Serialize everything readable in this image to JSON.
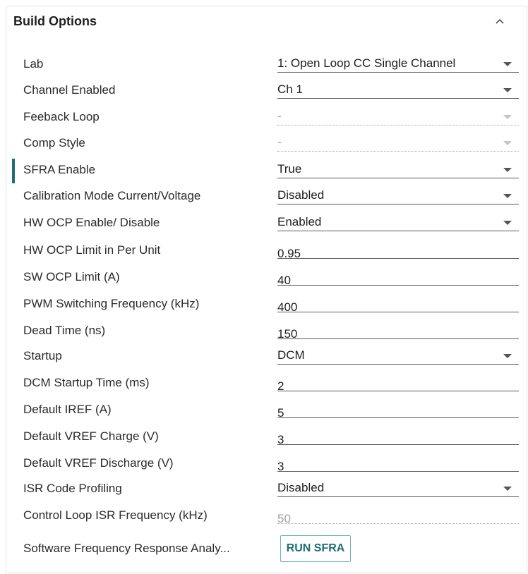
{
  "panel": {
    "title": "Build Options",
    "collapse_icon": "chevron-up-icon",
    "accent_color": "#1f6e78"
  },
  "options": [
    {
      "label": "Lab",
      "value": "1: Open Loop CC Single Channel",
      "type": "select"
    },
    {
      "label": "Channel Enabled",
      "value": "Ch 1",
      "type": "select"
    },
    {
      "label": "Feeback Loop",
      "value": "-",
      "type": "select",
      "disabled": true
    },
    {
      "label": "Comp Style",
      "value": "-",
      "type": "select",
      "disabled": true
    },
    {
      "label": "SFRA Enable",
      "value": "True",
      "type": "select"
    },
    {
      "label": "Calibration Mode Current/Voltage",
      "value": "Disabled",
      "type": "select"
    },
    {
      "label": "HW OCP Enable/ Disable",
      "value": "Enabled",
      "type": "select"
    },
    {
      "label": "HW OCP Limit in Per Unit",
      "value": "0.95",
      "type": "text"
    },
    {
      "label": "SW OCP Limit (A)",
      "value": "40",
      "type": "text"
    },
    {
      "label": "PWM Switching Frequency (kHz)",
      "value": "400",
      "type": "text"
    },
    {
      "label": "Dead Time (ns)",
      "value": "150",
      "type": "text"
    },
    {
      "label": "Startup",
      "value": "DCM",
      "type": "select"
    },
    {
      "label": "DCM Startup Time (ms)",
      "value": "2",
      "type": "text"
    },
    {
      "label": "Default IREF (A)",
      "value": "5",
      "type": "text"
    },
    {
      "label": "Default VREF Charge (V)",
      "value": "3",
      "type": "text"
    },
    {
      "label": "Default VREF Discharge (V)",
      "value": "3",
      "type": "text"
    },
    {
      "label": "ISR Code Profiling",
      "value": "Disabled",
      "type": "select"
    },
    {
      "label": "Control Loop ISR Frequency (kHz)",
      "value": "50",
      "type": "text",
      "disabled": true
    },
    {
      "label": "Software Frequency Response Analy...",
      "button_label": "RUN SFRA",
      "type": "button"
    }
  ]
}
